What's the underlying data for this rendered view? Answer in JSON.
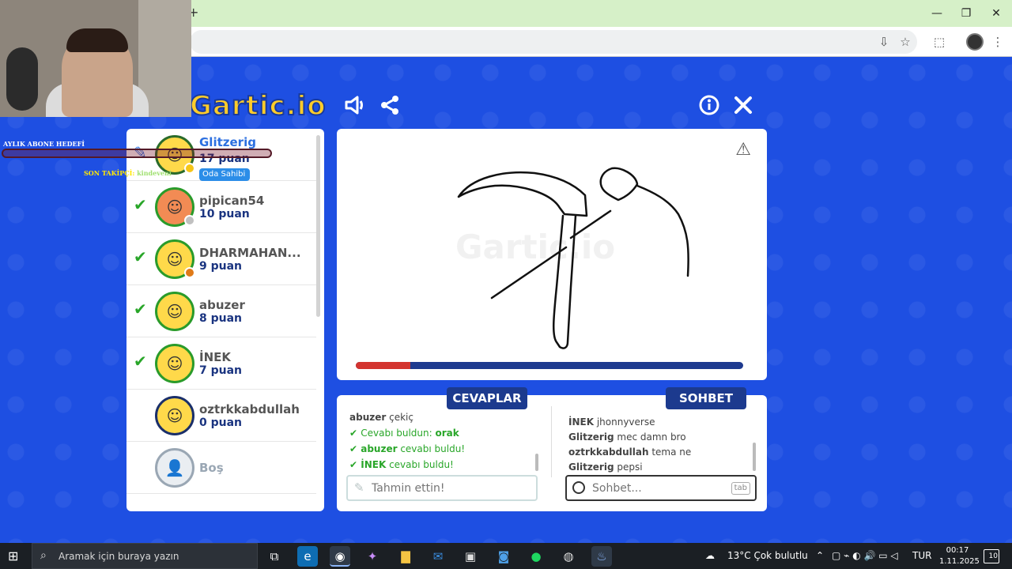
{
  "taskbar": {
    "search_placeholder": "Aramak için buraya yazın",
    "weather": "13°C Çok bulutlu",
    "language": "TUR",
    "time": "00:17",
    "date": "1.11.2025",
    "notifications": "10"
  },
  "overlay": {
    "goal_label": "AYLIK ABONE HEDEFİ",
    "follower_label": "SON TAKİPÇİ:",
    "follower_name": "kindeveni"
  },
  "game": {
    "logo": "Gartic.io",
    "watermark": "Gartic.io"
  },
  "players": [
    {
      "name": "Glitzerig",
      "points": "17 puan",
      "guessed": false,
      "drawing": true,
      "owner_badge": "Oda Sahibi",
      "dot_color": "#f5c518",
      "avatar_color": "#ffd94a",
      "ring_color": "#2a6b2a"
    },
    {
      "name": "pipican54",
      "points": "10 puan",
      "guessed": true,
      "drawing": false,
      "dot_color": "#c0c0c0",
      "avatar_color": "#f28b54",
      "ring_color": "#2a9b2a"
    },
    {
      "name": "DHARMAHAN...",
      "points": "9 puan",
      "guessed": true,
      "drawing": false,
      "dot_color": "#e07a18",
      "avatar_color": "#ffd94a",
      "ring_color": "#2a9b2a"
    },
    {
      "name": "abuzer",
      "points": "8 puan",
      "guessed": true,
      "drawing": false,
      "dot_color": "",
      "avatar_color": "#ffd94a",
      "ring_color": "#2a9b2a"
    },
    {
      "name": "İNEK",
      "points": "7 puan",
      "guessed": true,
      "drawing": false,
      "dot_color": "",
      "avatar_color": "#ffd94a",
      "ring_color": "#2a9b2a"
    },
    {
      "name": "oztrkkabdullah",
      "points": "0 puan",
      "guessed": false,
      "drawing": false,
      "dot_color": "",
      "avatar_color": "#ffd94a",
      "ring_color": "#1a2f6a"
    },
    {
      "name": "Boş",
      "points": "",
      "guessed": false,
      "drawing": false,
      "dot_color": "",
      "avatar_color": "#eaeef2",
      "ring_color": "#9aa7b4",
      "empty": true
    }
  ],
  "round": {
    "time_remaining_fraction": 0.14
  },
  "answers": {
    "title": "CEVAPLAR",
    "messages": [
      {
        "prefix": "abuzer",
        "text": " çekiç",
        "green": false,
        "check": false
      },
      {
        "prefix": "",
        "text": "Cevabı buldun: ",
        "bold": "orak",
        "green": true,
        "check": true
      },
      {
        "prefix": "abuzer",
        "text": " cevabı buldu!",
        "green": true,
        "check": true
      },
      {
        "prefix": "İNEK",
        "text": " cevabı buldu!",
        "green": true,
        "check": true
      }
    ],
    "input_placeholder": "Tahmin ettin!"
  },
  "chat": {
    "title": "SOHBET",
    "messages": [
      {
        "user": "İNEK",
        "text": " jhonnyverse"
      },
      {
        "user": "Glitzerig",
        "text": " mec damn bro"
      },
      {
        "user": "oztrkkabdullah",
        "text": " tema ne"
      },
      {
        "user": "Glitzerig",
        "text": " pepsi"
      }
    ],
    "input_placeholder": "Sohbet...",
    "tab_hint": "tab"
  }
}
